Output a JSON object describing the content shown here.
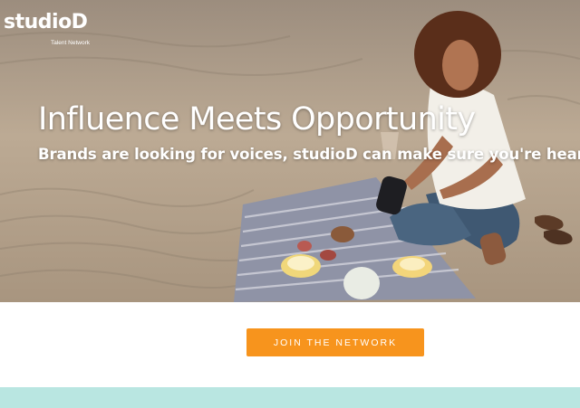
{
  "logo": {
    "wordmark": "studioD",
    "tagline": "Talent Network"
  },
  "hero": {
    "headline": "Influence Meets Opportunity",
    "subheadline": "Brands are looking for voices, studioD can make sure you're heard."
  },
  "cta": {
    "label": "JOIN THE NETWORK"
  },
  "colors": {
    "cta": "#f7941d",
    "band": "#b9e6e1",
    "text_on_hero": "#ffffff"
  }
}
